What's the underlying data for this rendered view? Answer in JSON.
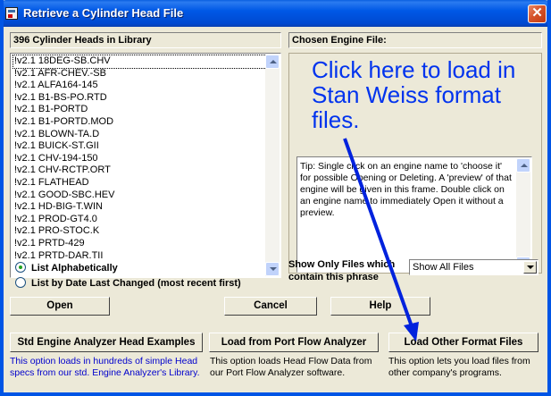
{
  "window": {
    "title": "Retrieve a Cylinder Head File",
    "close_label": "✕"
  },
  "library": {
    "header": "396 Cylinder Heads in Library",
    "items": [
      "!v2.1 18DEG-SB.CHV",
      "!v2.1 AFR-CHEV.-SB",
      "!v2.1 ALFA164-145",
      "!v2.1 B1-BS-PO.RTD",
      "!v2.1 B1-PORTD",
      "!v2.1 B1-PORTD.MOD",
      "!v2.1 BLOWN-TA.D",
      "!v2.1 BUICK-ST.GII",
      "!v2.1 CHV-194-150",
      "!v2.1 CHV-RCTP.ORT",
      "!v2.1 FLATHEAD",
      "!v2.1 GOOD-SBC.HEV",
      "!v2.1 HD-BIG-T.WIN",
      "!v2.1 PROD-GT4.0",
      "!v2.1 PRO-STOC.K",
      "!v2.1 PRTD-429",
      "!v2.1 PRTD-DAR.TII"
    ]
  },
  "chosen": {
    "header": "Chosen Engine File:"
  },
  "annotation": {
    "text": "Click here to load in Stan Weiss format files."
  },
  "tip": {
    "text": "Tip: Single click on an engine name to 'choose it' for possible Opening or Deleting. A 'preview' of that engine will be given in this frame.  Double click on an engine name to immediately Open it without a preview."
  },
  "sort": {
    "alpha_label": "List Alphabetically",
    "date_label": "List by Date Last Changed (most recent first)",
    "selected": "alpha"
  },
  "filter": {
    "label": "Show Only Files which contain this phrase",
    "value": "Show All Files"
  },
  "buttons": {
    "open": "Open",
    "cancel": "Cancel",
    "help": "Help",
    "std_examples": "Std Engine Analyzer Head Examples",
    "port_flow": "Load from Port Flow Analyzer",
    "other_format": "Load Other Format Files"
  },
  "descriptions": {
    "std_examples": "This option loads in hundreds of simple Head specs from our std. Engine Analyzer's Library.",
    "port_flow": "This option loads Head Flow Data from our Port Flow Analyzer software.",
    "other_format": "This option lets you load files from other company's programs."
  },
  "colors": {
    "titlebar": "#0058e6",
    "annotation": "#0033ee",
    "description_blue": "#0000cc"
  }
}
